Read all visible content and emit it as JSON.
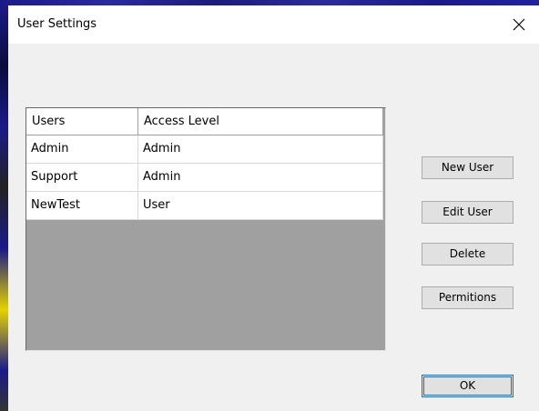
{
  "dialog": {
    "title": "User Settings",
    "close_icon": "close-icon"
  },
  "grid": {
    "columns": [
      "Users",
      "Access Level"
    ],
    "rows": [
      [
        "Admin",
        "Admin"
      ],
      [
        "Support",
        "Admin"
      ],
      [
        "NewTest",
        "User"
      ]
    ]
  },
  "buttons": {
    "new_user": "New User",
    "edit_user": "Edit User",
    "delete": "Delete",
    "permissions": "Permitions",
    "ok": "OK"
  }
}
